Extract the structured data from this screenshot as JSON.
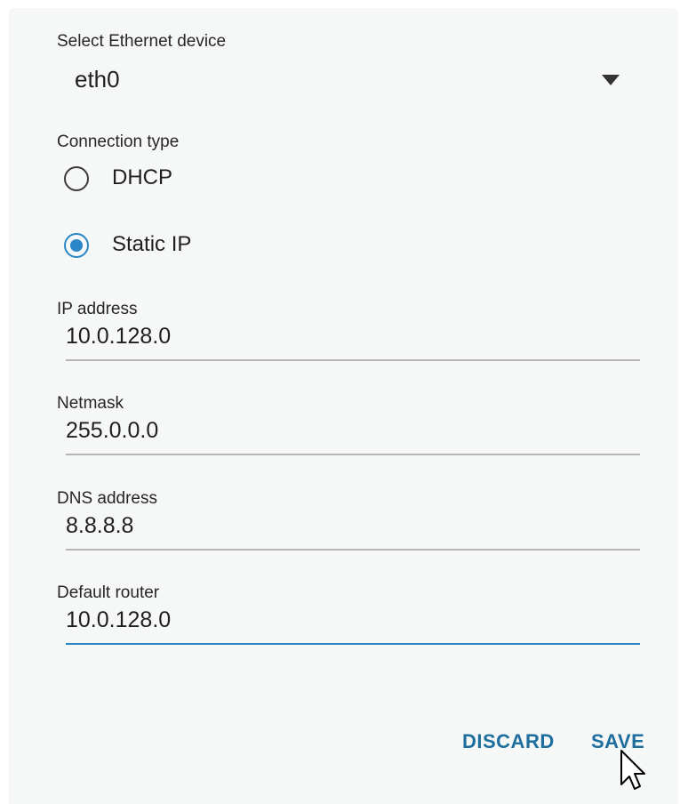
{
  "ethernet": {
    "label": "Select Ethernet device",
    "selected": "eth0"
  },
  "connection_type": {
    "label": "Connection type",
    "options": [
      {
        "label": "DHCP",
        "checked": false
      },
      {
        "label": "Static IP",
        "checked": true
      }
    ]
  },
  "fields": {
    "ip_address": {
      "label": "IP address",
      "value": "10.0.128.0"
    },
    "netmask": {
      "label": "Netmask",
      "value": "255.0.0.0"
    },
    "dns_address": {
      "label": "DNS address",
      "value": "8.8.8.8"
    },
    "default_router": {
      "label": "Default router",
      "value": "10.0.128.0"
    }
  },
  "actions": {
    "discard_label": "DISCARD",
    "save_label": "SAVE"
  },
  "colors": {
    "accent": "#2a86c6",
    "button_text": "#1e6f9e",
    "background": "#f6f7f7"
  },
  "icons": {
    "dropdown": "dropdown-arrow-icon",
    "cursor": "mouse-pointer-icon"
  }
}
